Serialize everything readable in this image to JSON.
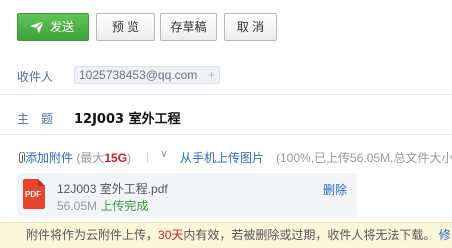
{
  "toolbar": {
    "send_label": "发送",
    "preview_label": "预 览",
    "save_draft_label": "存草稿",
    "cancel_label": "取 消"
  },
  "recipient": {
    "label": "收件人",
    "chips": [
      "1025738453@qq.com"
    ]
  },
  "subject": {
    "label": "主　题",
    "value": "12J003 室外工程"
  },
  "attachments": {
    "add_label": "添加附件",
    "limit_prefix": "(最大",
    "limit_value": "15G",
    "limit_suffix": ")",
    "phone_upload_label": "从手机上传图片",
    "quota_text": "(100%,已上传56.05M,总文件大小"
  },
  "file": {
    "icon_text": "PDF",
    "name": "12J003 室外工程.pdf",
    "size": "56.05M",
    "status": "上传完成",
    "delete_label": "删除"
  },
  "notice": {
    "text_before": "附件将作为云附件上传，",
    "days": "30天",
    "text_after": "内有效，若被删除或过期，收件人将无法下载。",
    "link": "修"
  },
  "colors": {
    "send_green": "#4cae47",
    "link_blue": "#2b6ac0",
    "limit_red": "#d21e1e",
    "notice_bg": "#fbf6da"
  }
}
